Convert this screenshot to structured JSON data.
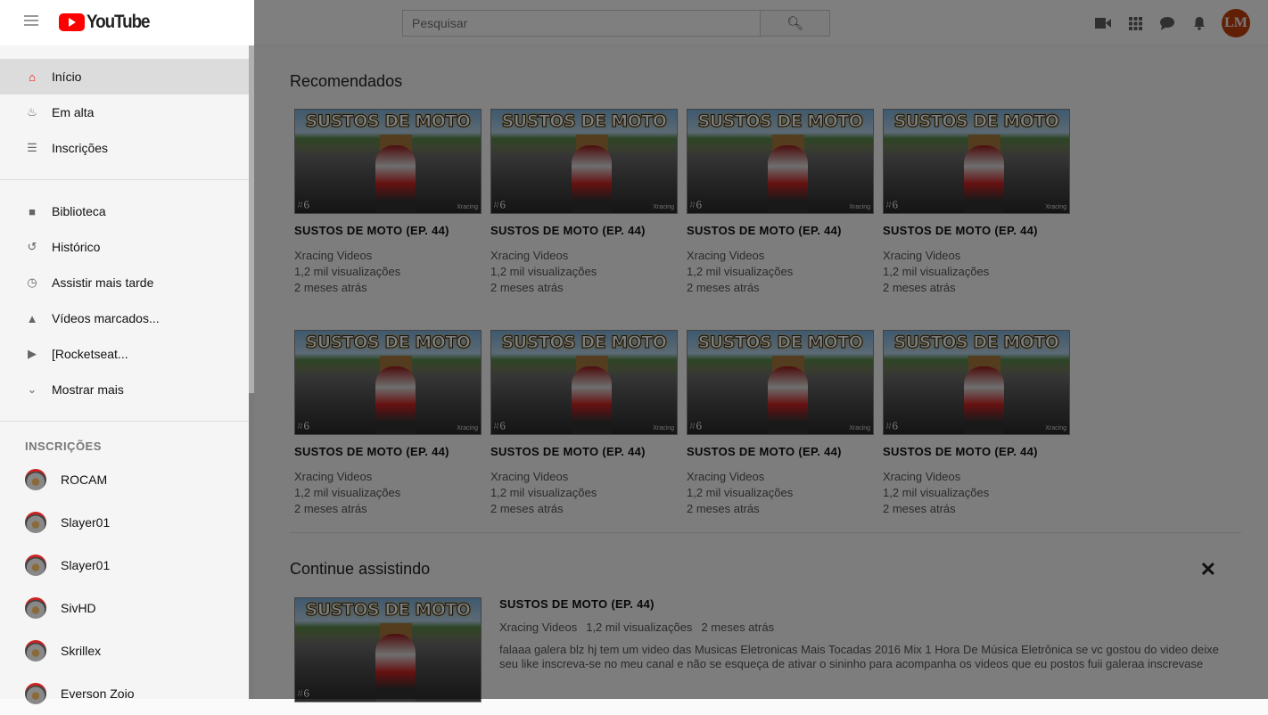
{
  "header": {
    "logo": "YouTube",
    "search_placeholder": "Pesquisar",
    "icons": [
      "video-camera-icon",
      "apps-grid-icon",
      "chat-icon",
      "bell-icon"
    ],
    "avatar_initials": "LM"
  },
  "sidebar": {
    "main": [
      {
        "label": "Início",
        "icon": "home-icon",
        "active": true
      },
      {
        "label": "Em alta",
        "icon": "flame-icon"
      },
      {
        "label": "Inscrições",
        "icon": "subscriptions-icon"
      }
    ],
    "library": [
      {
        "label": "Biblioteca",
        "icon": "folder-icon"
      },
      {
        "label": "Histórico",
        "icon": "history-icon"
      },
      {
        "label": "Assistir mais tarde",
        "icon": "clock-icon"
      },
      {
        "label": "Vídeos marcados...",
        "icon": "thumbs-up-icon"
      },
      {
        "label": "[Rocketseat...",
        "icon": "play-icon"
      },
      {
        "label": "Mostrar mais",
        "icon": "chevron-down-icon"
      }
    ],
    "subs_heading": "INSCRIÇÕES",
    "subs": [
      "ROCAM",
      "Slayer01",
      "Slayer01",
      "SivHD",
      "Skrillex",
      "Everson Zoio"
    ]
  },
  "recommended": {
    "heading": "Recomendados",
    "videos": [
      {
        "thumb_text": "SUSTOS DE MOTO",
        "thumb_num": "#6",
        "thumb_brand": "Xracing",
        "title": "SUSTOS DE MOTO (EP. 44)",
        "channel": "Xracing Videos",
        "views": "1,2 mil visualizações",
        "age": "2 meses atrás"
      },
      {
        "thumb_text": "SUSTOS DE MOTO",
        "thumb_num": "#6",
        "thumb_brand": "Xracing",
        "title": "SUSTOS DE MOTO (EP. 44)",
        "channel": "Xracing Videos",
        "views": "1,2 mil visualizações",
        "age": "2 meses atrás"
      },
      {
        "thumb_text": "SUSTOS DE MOTO",
        "thumb_num": "#6",
        "thumb_brand": "Xracing",
        "title": "SUSTOS DE MOTO (EP. 44)",
        "channel": "Xracing Videos",
        "views": "1,2 mil visualizações",
        "age": "2 meses atrás"
      },
      {
        "thumb_text": "SUSTOS DE MOTO",
        "thumb_num": "#6",
        "thumb_brand": "Xracing",
        "title": "SUSTOS DE MOTO (EP. 44)",
        "channel": "Xracing Videos",
        "views": "1,2 mil visualizações",
        "age": "2 meses atrás"
      },
      {
        "thumb_text": "SUSTOS DE MOTO",
        "thumb_num": "#6",
        "thumb_brand": "Xracing",
        "title": "SUSTOS DE MOTO (EP. 44)",
        "channel": "Xracing Videos",
        "views": "1,2 mil visualizações",
        "age": "2 meses atrás"
      },
      {
        "thumb_text": "SUSTOS DE MOTO",
        "thumb_num": "#6",
        "thumb_brand": "Xracing",
        "title": "SUSTOS DE MOTO (EP. 44)",
        "channel": "Xracing Videos",
        "views": "1,2 mil visualizações",
        "age": "2 meses atrás"
      },
      {
        "thumb_text": "SUSTOS DE MOTO",
        "thumb_num": "#6",
        "thumb_brand": "Xracing",
        "title": "SUSTOS DE MOTO (EP. 44)",
        "channel": "Xracing Videos",
        "views": "1,2 mil visualizações",
        "age": "2 meses atrás"
      },
      {
        "thumb_text": "SUSTOS DE MOTO",
        "thumb_num": "#6",
        "thumb_brand": "Xracing",
        "title": "SUSTOS DE MOTO (EP. 44)",
        "channel": "Xracing Videos",
        "views": "1,2 mil visualizações",
        "age": "2 meses atrás"
      }
    ]
  },
  "continue": {
    "heading": "Continue assistindo",
    "close": "✕",
    "video": {
      "thumb_text": "SUSTOS DE MOTO",
      "thumb_num": "#6",
      "title": "SUSTOS DE MOTO (EP. 44)",
      "channel": "Xracing Videos",
      "views": "1,2 mil visualizações",
      "age": "2 meses atrás",
      "description": "falaaa galera blz hj tem um video das Musicas Eletronicas Mais Tocadas 2016 Mix 1 Hora De Música Eletrônica se vc gostou do video deixe seu like inscreva-se no meu canal e não se esqueça de ativar o sininho para acompanha os videos que eu postos fuii galeraa inscrevase"
    }
  },
  "colors": {
    "brand": "#ff0000",
    "overlay": "rgba(0,0,0,0.5)"
  }
}
